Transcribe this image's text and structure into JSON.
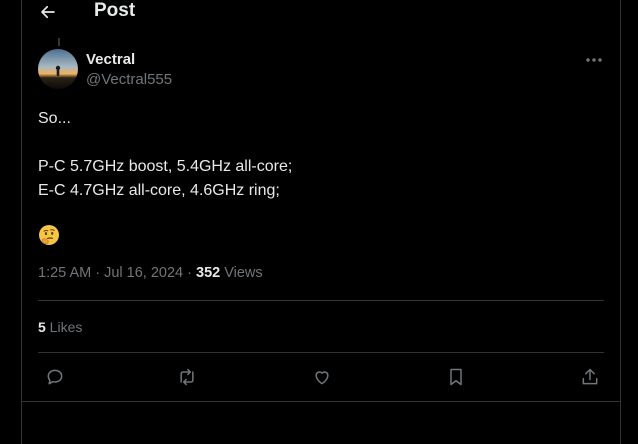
{
  "header": {
    "title": "Post"
  },
  "author": {
    "display_name": "Vectral",
    "handle": "@Vectral555"
  },
  "post": {
    "lines": [
      "So...",
      "",
      "P-C 5.7GHz boost, 5.4GHz all-core;",
      "E-C 4.7GHz all-core, 4.6GHz ring;"
    ],
    "emoji": "thinking-face-emoji"
  },
  "meta": {
    "time": "1:25 AM",
    "separator": " · ",
    "date": "Jul 16, 2024",
    "views_count": "352",
    "views_label": " Views"
  },
  "stats": {
    "likes_count": "5",
    "likes_label": " Likes"
  },
  "actions": [
    "reply-icon",
    "repost-icon",
    "like-icon",
    "bookmark-icon",
    "share-icon"
  ],
  "colors": {
    "background": "#000000",
    "text": "#e7e9ea",
    "muted": "#71767b",
    "border": "#2f3336"
  }
}
